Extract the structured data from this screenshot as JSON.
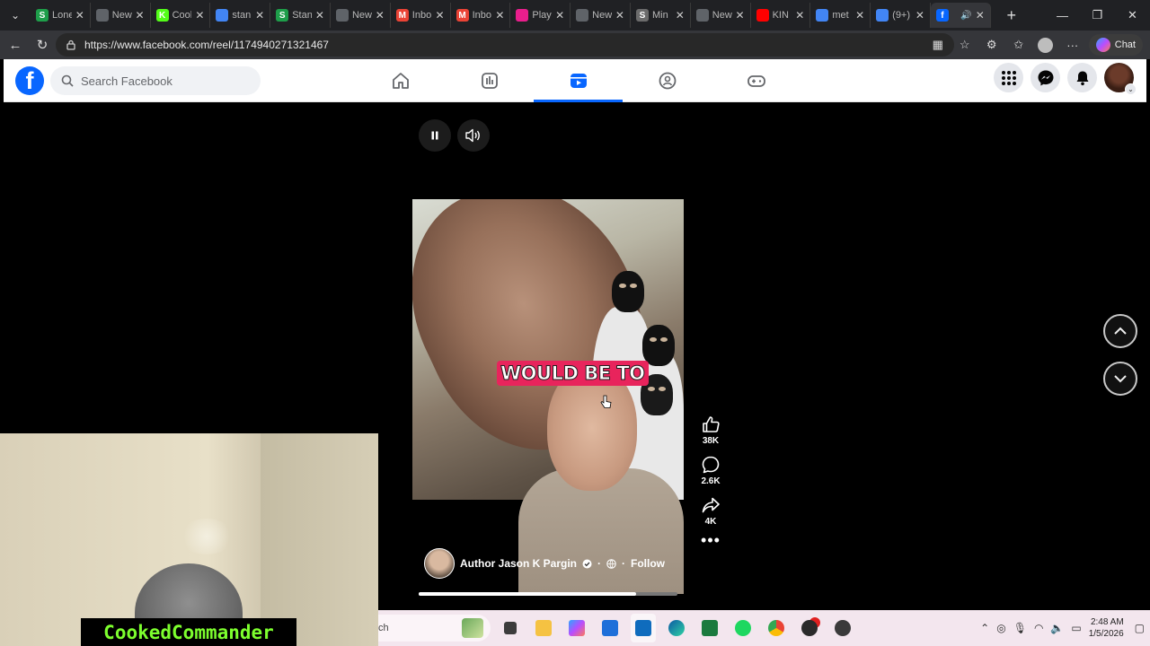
{
  "browser": {
    "tabs": [
      {
        "title": "Lone",
        "fav": "S",
        "color": "#1e9e4a",
        "icon": "s-brand-icon"
      },
      {
        "title": "New",
        "fav": "",
        "color": "#5f6368",
        "icon": "newtab-icon"
      },
      {
        "title": "Cool",
        "fav": "K",
        "color": "#53fc18",
        "icon": "k-brand-icon"
      },
      {
        "title": "stan",
        "fav": "",
        "color": "#4285f4",
        "icon": "search-icon"
      },
      {
        "title": "Stan",
        "fav": "S",
        "color": "#1e9e4a",
        "icon": "s-brand-icon"
      },
      {
        "title": "New",
        "fav": "",
        "color": "#5f6368",
        "icon": "newtab-icon"
      },
      {
        "title": "Inbo",
        "fav": "M",
        "color": "#ea4335",
        "icon": "gmail-icon"
      },
      {
        "title": "Inbo",
        "fav": "M",
        "color": "#ea4335",
        "icon": "gmail-icon"
      },
      {
        "title": "Play",
        "fav": "",
        "color": "#e91e8c",
        "icon": "play-brand-icon"
      },
      {
        "title": "New",
        "fav": "",
        "color": "#5f6368",
        "icon": "newtab-icon"
      },
      {
        "title": "Min",
        "fav": "S",
        "color": "#6b6b6b",
        "icon": "s-brand-icon"
      },
      {
        "title": "New",
        "fav": "",
        "color": "#5f6368",
        "icon": "newtab-icon"
      },
      {
        "title": "KIN",
        "fav": "",
        "color": "#ff0000",
        "icon": "youtube-icon"
      },
      {
        "title": "met",
        "fav": "",
        "color": "#4285f4",
        "icon": "search-icon"
      },
      {
        "title": "(9+)",
        "fav": "",
        "color": "#4285f4",
        "icon": "loading-icon"
      },
      {
        "title": "",
        "fav": "f",
        "color": "#0866ff",
        "icon": "facebook-icon",
        "active": true
      }
    ],
    "url": "https://www.facebook.com/reel/1174940271321467",
    "chat_label": "Chat"
  },
  "facebook": {
    "search_placeholder": "Search Facebook",
    "nav": [
      "home",
      "video",
      "reels",
      "groups",
      "gaming"
    ],
    "active_nav": "reels"
  },
  "reel": {
    "caption": "WOULD BE TO",
    "author": "Author Jason K Pargin",
    "follow_label": "Follow",
    "separator": "·",
    "likes": "38K",
    "comments": "2.6K",
    "shares": "4K",
    "progress_fraction": 0.84
  },
  "webcam": {
    "name": "CookedCommander"
  },
  "taskbar": {
    "search_fragment": "ch",
    "time": "2:48 AM",
    "date": "1/5/2026"
  },
  "colors": {
    "fb_blue": "#0866ff",
    "caption_bg": "#e8245c",
    "nametag_text": "#7dff2e"
  }
}
